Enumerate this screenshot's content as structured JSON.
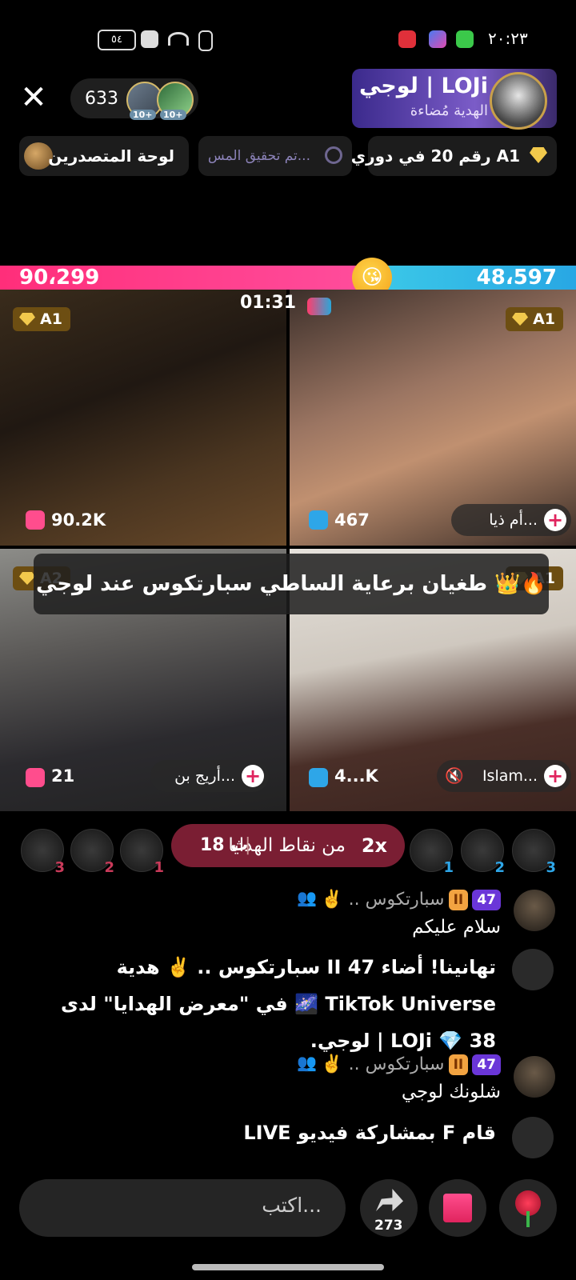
{
  "status_bar": {
    "time": "٢٠:٢٣",
    "battery": "٥٤"
  },
  "header": {
    "viewer_count": "633",
    "viewer_levels": [
      "10+",
      "10+"
    ],
    "host_name": "لوجي | LOJi",
    "host_subtitle": "الهدية مُضاءة"
  },
  "chips": {
    "leaderboard": "لوحة المتصدرين",
    "mission": "تم تحقيق المس...",
    "rank": "رقم 20 في دوري A1"
  },
  "battle": {
    "left_score": "90،299",
    "right_score": "48،597",
    "timer": "01:31"
  },
  "tiles": [
    {
      "league": "A1",
      "score": "90.2K"
    },
    {
      "league": "A1",
      "score": "467",
      "name": "أم ذيا..."
    },
    {
      "league": "A2",
      "score": "21",
      "name": "أريج بن..."
    },
    {
      "league": "A1",
      "score": "4...K",
      "name": "Islam..."
    }
  ],
  "banner": "طغيان برعاية الساطي سبارتكوس عند لوجي 👑🔥",
  "boost": {
    "multiplier": "2x",
    "message": "من نقاط الهدايا",
    "timer": "18 ث"
  },
  "fans_left_ranks": [
    "3",
    "2",
    "1"
  ],
  "fans_right_ranks": [
    "1",
    "2",
    "3"
  ],
  "chat": [
    {
      "level": "47",
      "fan_badge": "II",
      "username": "سبارتكوس .. ✌️",
      "message": "سلام عليكم"
    },
    {
      "type": "gift",
      "text": "تهانينا! أضاء 47 II سبارتكوس .. ✌️ هدية TikTok Universe 🌌 في \"معرض الهدايا\" لدى 38 💎 LOJi | لوجي."
    },
    {
      "level": "47",
      "fan_badge": "II",
      "username": "سبارتكوس .. ✌️",
      "message": "شلونك لوجي"
    },
    {
      "type": "share",
      "text": "قام F بمشاركة فيديو LIVE"
    }
  ],
  "bottom": {
    "input_placeholder": "اكتب...",
    "share_count": "273"
  }
}
